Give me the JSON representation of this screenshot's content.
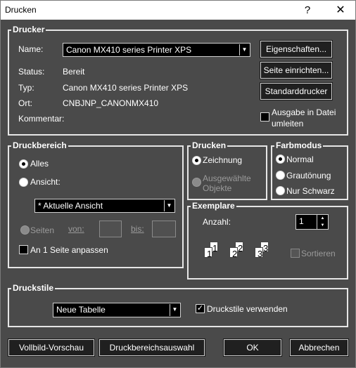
{
  "window": {
    "title": "Drucken",
    "help_glyph": "?",
    "close_glyph": "✕"
  },
  "printer": {
    "legend": "Drucker",
    "name_label": "Name:",
    "name_value": "Canon MX410 series Printer XPS",
    "status_label": "Status:",
    "status_value": "Bereit",
    "type_label": "Typ:",
    "type_value": "Canon MX410 series Printer XPS",
    "location_label": "Ort:",
    "location_value": "CNBJNP_CANONMX410",
    "comment_label": "Kommentar:",
    "properties_button": "Eigenschaften...",
    "page_setup_button": "Seite einrichten...",
    "default_printer_button": "Standarddrucker",
    "print_to_file_line1": "Ausgabe in Datei",
    "print_to_file_line2": "umleiten",
    "print_to_file_checked": false
  },
  "print_range": {
    "legend": "Druckbereich",
    "all_label": "Alles",
    "all_selected": true,
    "view_label": "Ansicht:",
    "view_value": "* Aktuelle Ansicht",
    "pages_label": "Seiten",
    "from_label": "von:",
    "to_label": "bis:",
    "fit_label": "An 1 Seite anpassen",
    "fit_checked": false
  },
  "print_mode": {
    "legend": "Drucken",
    "drawing_label": "Zeichnung",
    "drawing_selected": true,
    "selected_objects_line1": "Ausgewählte",
    "selected_objects_line2": "Objekte"
  },
  "color_mode": {
    "legend": "Farbmodus",
    "normal_label": "Normal",
    "normal_selected": true,
    "grayscale_label": "Grautönung",
    "bw_label": "Nur Schwarz"
  },
  "copies": {
    "legend": "Exemplare",
    "count_label": "Anzahl:",
    "count_value": "1",
    "collate_label": "Sortieren",
    "collate_checked": false,
    "page_numbers": [
      "1",
      "1",
      "2",
      "2",
      "3",
      "3"
    ]
  },
  "plot_styles": {
    "legend": "Druckstile",
    "style_value": "Neue Tabelle",
    "use_styles_label": "Druckstile verwenden",
    "use_styles_checked": true
  },
  "footer": {
    "preview_button": "Vollbild-Vorschau",
    "area_button": "Druckbereichsauswahl",
    "ok_button": "OK",
    "cancel_button": "Abbrechen"
  }
}
